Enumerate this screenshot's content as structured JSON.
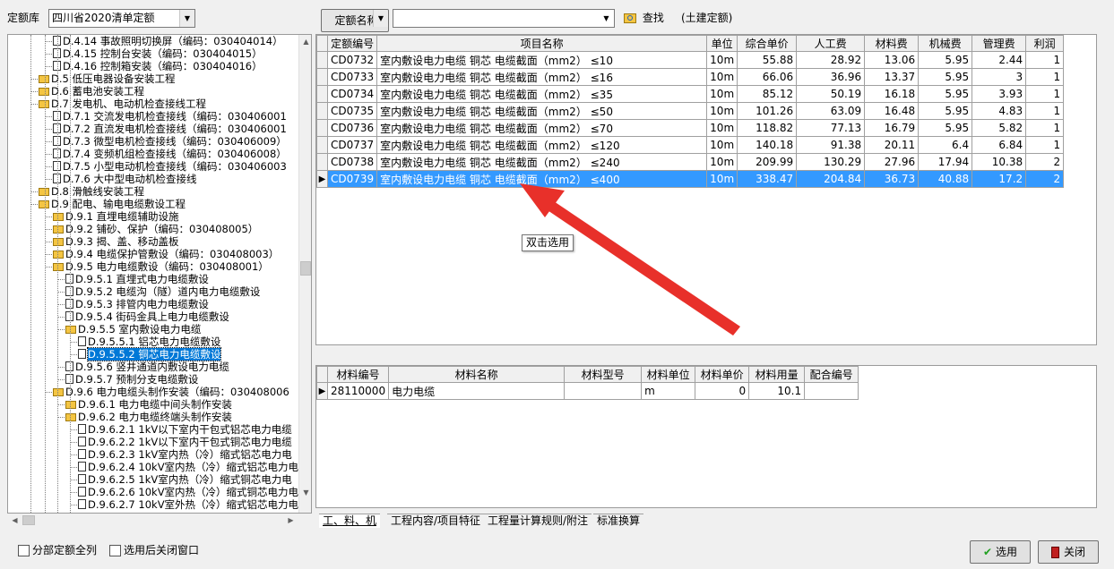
{
  "toolbar": {
    "library_label": "定额库",
    "library_value": "四川省2020清单定额",
    "search_field_value": "定额名称",
    "search_input_value": "",
    "find_label": "查找",
    "scope_label": "(土建定额)"
  },
  "tree": [
    {
      "text": "D.4.14 事故照明切换屏（编码：030404014）",
      "level": 3,
      "icon": "doc"
    },
    {
      "text": "D.4.15 控制台安装（编码：030404015）",
      "level": 3,
      "icon": "doc"
    },
    {
      "text": "D.4.16 控制箱安装（编码：030404016）",
      "level": 3,
      "icon": "doc"
    },
    {
      "text": "D.5 低压电器设备安装工程",
      "level": 2,
      "icon": "folder"
    },
    {
      "text": "D.6 蓄电池安装工程",
      "level": 2,
      "icon": "folder"
    },
    {
      "text": "D.7 发电机、电动机检查接线工程",
      "level": 2,
      "icon": "folder"
    },
    {
      "text": "D.7.1 交流发电机检查接线（编码：030406001",
      "level": 3,
      "icon": "doc"
    },
    {
      "text": "D.7.2 直流发电机检查接线（编码：030406001",
      "level": 3,
      "icon": "doc"
    },
    {
      "text": "D.7.3 微型电机检查接线（编码：030406009）",
      "level": 3,
      "icon": "doc"
    },
    {
      "text": "D.7.4 变频机组检查接线（编码：030406008）",
      "level": 3,
      "icon": "doc"
    },
    {
      "text": "D.7.5 小型电动机检查接线（编码：030406003",
      "level": 3,
      "icon": "doc"
    },
    {
      "text": "D.7.6 大中型电动机检查接线",
      "level": 3,
      "icon": "doc"
    },
    {
      "text": "D.8 滑触线安装工程",
      "level": 2,
      "icon": "folder"
    },
    {
      "text": "D.9 配电、输电电缆敷设工程",
      "level": 2,
      "icon": "folder"
    },
    {
      "text": "D.9.1 直埋电缆辅助设施",
      "level": 3,
      "icon": "folder"
    },
    {
      "text": "D.9.2 铺砂、保护（编码：030408005）",
      "level": 3,
      "icon": "folder"
    },
    {
      "text": "D.9.3 揭、盖、移动盖板",
      "level": 3,
      "icon": "folder"
    },
    {
      "text": "D.9.4 电缆保护管敷设（编码：030408003）",
      "level": 3,
      "icon": "folder"
    },
    {
      "text": "D.9.5 电力电缆敷设（编码：030408001）",
      "level": 3,
      "icon": "folder"
    },
    {
      "text": "D.9.5.1 直埋式电力电缆敷设",
      "level": 4,
      "icon": "doc"
    },
    {
      "text": "D.9.5.2 电缆沟（隧）道内电力电缆敷设",
      "level": 4,
      "icon": "doc"
    },
    {
      "text": "D.9.5.3 排管内电力电缆敷设",
      "level": 4,
      "icon": "doc"
    },
    {
      "text": "D.9.5.4 街码金具上电力电缆敷设",
      "level": 4,
      "icon": "doc"
    },
    {
      "text": "D.9.5.5 室内敷设电力电缆",
      "level": 4,
      "icon": "folder"
    },
    {
      "text": "D.9.5.5.1 铝芯电力电缆敷设",
      "level": 5,
      "icon": "doc"
    },
    {
      "text": "D.9.5.5.2 铜芯电力电缆敷设",
      "level": 5,
      "icon": "doc",
      "selected": true
    },
    {
      "text": "D.9.5.6 竖井通道内敷设电力电缆",
      "level": 4,
      "icon": "doc"
    },
    {
      "text": "D.9.5.7 预制分支电缆敷设",
      "level": 4,
      "icon": "doc"
    },
    {
      "text": "D.9.6 电力电缆头制作安装（编码：030408006",
      "level": 3,
      "icon": "folder"
    },
    {
      "text": "D.9.6.1 电力电缆中间头制作安装",
      "level": 4,
      "icon": "folder"
    },
    {
      "text": "D.9.6.2 电力电缆终端头制作安装",
      "level": 4,
      "icon": "folder"
    },
    {
      "text": "D.9.6.2.1 1kV以下室内干包式铝芯电力电缆",
      "level": 5,
      "icon": "doc"
    },
    {
      "text": "D.9.6.2.2 1kV以下室内干包式铜芯电力电缆",
      "level": 5,
      "icon": "doc"
    },
    {
      "text": "D.9.6.2.3 1kV室内热（冷）缩式铝芯电力电",
      "level": 5,
      "icon": "doc"
    },
    {
      "text": "D.9.6.2.4 10kV室内热（冷）缩式铝芯电力电",
      "level": 5,
      "icon": "doc"
    },
    {
      "text": "D.9.6.2.5 1kV室内热（冷）缩式铜芯电力电",
      "level": 5,
      "icon": "doc"
    },
    {
      "text": "D.9.6.2.6 10kV室内热（冷）缩式铜芯电力电",
      "level": 5,
      "icon": "doc"
    },
    {
      "text": "D.9.6.2.7 10kV室外热（冷）缩式铝芯电力电",
      "level": 5,
      "icon": "doc"
    }
  ],
  "grid": {
    "headers": [
      "定额编号",
      "项目名称",
      "单位",
      "综合单价",
      "人工费",
      "材料费",
      "机械费",
      "管理费",
      "利润"
    ],
    "rows": [
      [
        "CD0732",
        "室内敷设电力电缆 铜芯 电缆截面（mm2） ≤10",
        "10m",
        "55.88",
        "28.92",
        "13.06",
        "5.95",
        "2.44",
        "1"
      ],
      [
        "CD0733",
        "室内敷设电力电缆 铜芯 电缆截面（mm2） ≤16",
        "10m",
        "66.06",
        "36.96",
        "13.37",
        "5.95",
        "3",
        "1"
      ],
      [
        "CD0734",
        "室内敷设电力电缆 铜芯 电缆截面（mm2） ≤35",
        "10m",
        "85.12",
        "50.19",
        "16.18",
        "5.95",
        "3.93",
        "1"
      ],
      [
        "CD0735",
        "室内敷设电力电缆 铜芯 电缆截面（mm2） ≤50",
        "10m",
        "101.26",
        "63.09",
        "16.48",
        "5.95",
        "4.83",
        "1"
      ],
      [
        "CD0736",
        "室内敷设电力电缆 铜芯 电缆截面（mm2） ≤70",
        "10m",
        "118.82",
        "77.13",
        "16.79",
        "5.95",
        "5.82",
        "1"
      ],
      [
        "CD0737",
        "室内敷设电力电缆 铜芯 电缆截面（mm2） ≤120",
        "10m",
        "140.18",
        "91.38",
        "20.11",
        "6.4",
        "6.84",
        "1"
      ],
      [
        "CD0738",
        "室内敷设电力电缆 铜芯 电缆截面（mm2） ≤240",
        "10m",
        "209.99",
        "130.29",
        "27.96",
        "17.94",
        "10.38",
        "2"
      ],
      [
        "CD0739",
        "室内敷设电力电缆 铜芯 电缆截面（mm2） ≤400",
        "10m",
        "338.47",
        "204.84",
        "36.73",
        "40.88",
        "17.2",
        "2"
      ]
    ],
    "selected_row": 7
  },
  "tooltip": "双击选用",
  "materials": {
    "headers": [
      "材料编号",
      "材料名称",
      "材料型号",
      "材料单位",
      "材料单价",
      "材料用量",
      "配合编号"
    ],
    "rows": [
      [
        "28110000",
        "电力电缆",
        "",
        "m",
        "0",
        "10.1",
        ""
      ]
    ]
  },
  "tabs": [
    "工、料、机",
    "工程内容/项目特征",
    "工程量计算规则/附注",
    "标准换算"
  ],
  "footer": {
    "list_all_label": "分部定额全列",
    "close_after_label": "选用后关闭窗口",
    "select_button": "选用",
    "close_button": "关闭"
  },
  "colors": {
    "selection": "#3399ff",
    "arrow": "#e8302a",
    "tree_selection": "#0078d7"
  }
}
